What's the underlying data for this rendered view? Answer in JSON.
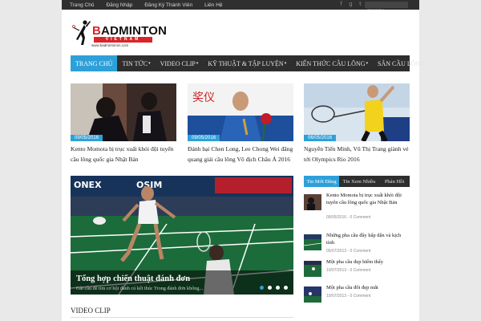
{
  "topbar": {
    "links": [
      "Trang Chủ",
      "Đăng Nhập",
      "Đăng Ký Thành Viên",
      "Liên Hệ"
    ],
    "social_icons": [
      "facebook-icon",
      "google-plus-icon",
      "twitter-icon"
    ],
    "search_placeholder": "SEARCH..."
  },
  "logo": {
    "word_a": "B",
    "word_rest": "ADMINTON",
    "band": "VIETNAM",
    "url": "www.badmintonvn.com"
  },
  "nav": [
    {
      "label": "TRANG CHỦ",
      "active": true,
      "caret": ""
    },
    {
      "label": "TIN TỨC",
      "active": false,
      "caret": "▾"
    },
    {
      "label": "VIDEO CLIP",
      "active": false,
      "caret": "▾"
    },
    {
      "label": "KỸ THUẬT & TẬP LUYỆN",
      "active": false,
      "caret": "▾"
    },
    {
      "label": "KIẾN THỨC CẦU LÔNG",
      "active": false,
      "caret": "▾"
    },
    {
      "label": "SÂN CẦU LÔNG",
      "active": false,
      "caret": ""
    }
  ],
  "cards": [
    {
      "date": "09/05/2016",
      "title": "Kento Momota bị trục xuất khỏi đội tuyển cầu lông quốc gia Nhật Bản"
    },
    {
      "date": "09/05/2016",
      "title": "Đánh bại Chen Long, Lee Chong Wei đăng quang giải cầu lông Vô địch Châu Á 2016"
    },
    {
      "date": "06/05/2016",
      "title": "Nguyễn Tiến Minh, Vũ Thị Trang giành vé tới Olympics Rio 2016"
    }
  ],
  "slider": {
    "title": "Tổng hợp chiến thuật đánh đơn",
    "excerpt": "Gài cầu để tìm cơ hội đánh cú kết thúc Trong đánh đơn không...",
    "active_dot": 0,
    "dot_count": 4
  },
  "tabs": [
    "Tin Mới Đăng",
    "Tin Xem Nhiều",
    "Phản Hồi"
  ],
  "recent": [
    {
      "title": "Kento Momota bị trục xuất khỏi đội tuyển cầu lông quốc gia Nhật Bản",
      "meta": "09/05/2016 - 0 Comment"
    },
    {
      "title": "Những pha cầu đầy hấp dẫn và kịch tính",
      "meta": "05/07/2013 - 0 Comment"
    },
    {
      "title": "Một pha cầu đẹp hiếm thấy",
      "meta": "10/07/2013 - 0 Comment"
    },
    {
      "title": "Một pha cầu đôi đẹp mắt",
      "meta": "10/07/2013 - 0 Comment"
    }
  ],
  "section": {
    "video_title": "VIDEO CLIP"
  },
  "colors": {
    "accent": "#2ea0d9",
    "dark": "#2e2e2e",
    "brand_red": "#d9252a"
  }
}
